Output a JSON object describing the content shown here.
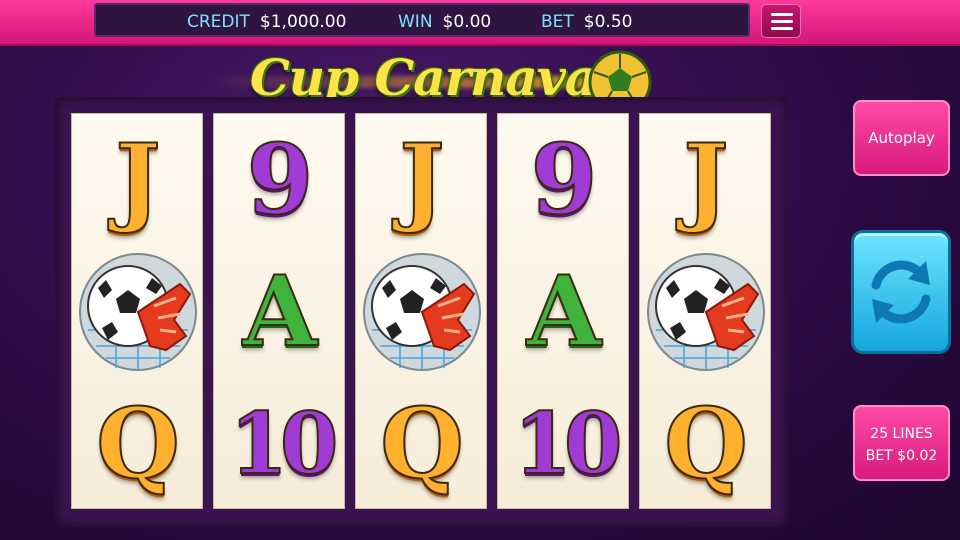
{
  "hud": {
    "credit_label": "CREDIT",
    "credit_value": "$1,000.00",
    "win_label": "WIN",
    "win_value": "$0.00",
    "bet_label": "BET",
    "bet_value": "$0.50"
  },
  "logo": {
    "title": "Cup Carnaval"
  },
  "reels": [
    [
      "J",
      "ball-glove",
      "Q"
    ],
    [
      "9",
      "A",
      "10"
    ],
    [
      "J",
      "ball-glove",
      "Q"
    ],
    [
      "9",
      "A",
      "10"
    ],
    [
      "J",
      "ball-glove",
      "Q"
    ]
  ],
  "buttons": {
    "autoplay_label": "Autoplay",
    "spin_icon": "refresh-arrows-icon",
    "lines_label": "25 LINES",
    "bet_line_label": "BET $0.02"
  },
  "colors": {
    "topbar": "#e61e87",
    "spin": "#2bb8e8",
    "background": "#2d0b45"
  }
}
